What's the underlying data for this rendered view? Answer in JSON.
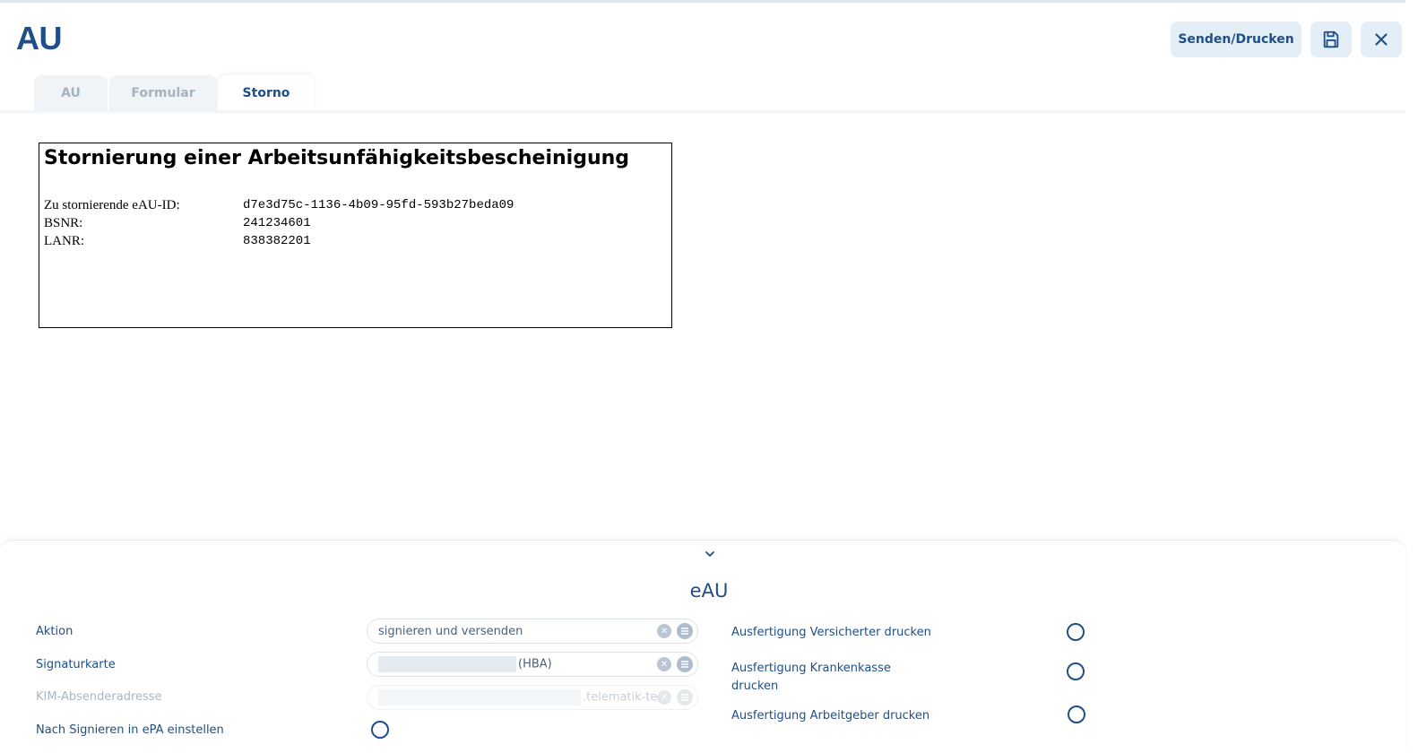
{
  "header": {
    "title": "AU",
    "send_print_label": "Senden/Drucken",
    "icons": {
      "save": "save-icon",
      "close": "close-icon"
    }
  },
  "tabs": [
    {
      "label": "AU",
      "active": false
    },
    {
      "label": "Formular",
      "active": false
    },
    {
      "label": "Storno",
      "active": true
    }
  ],
  "document": {
    "title": "Stornierung einer Arbeitsunfähigkeitsbescheinigung",
    "rows": [
      {
        "label": "Zu stornierende eAU-ID:",
        "value": "d7e3d75c-1136-4b09-95fd-593b27beda09"
      },
      {
        "label": "BSNR:",
        "value": "241234601"
      },
      {
        "label": "LANR:",
        "value": "838382201"
      }
    ]
  },
  "panel": {
    "title": "eAU",
    "fields": {
      "aktion": {
        "label": "Aktion",
        "value": "signieren und versenden"
      },
      "signaturkarte": {
        "label": "Signaturkarte",
        "value_suffix": "(HBA)"
      },
      "kim": {
        "label": "KIM-Absenderadresse",
        "value_suffix": ".telematik-test"
      },
      "epa": {
        "label": "Nach Signieren in ePA einstellen"
      }
    },
    "options": {
      "versicherter": "Ausfertigung Versicherter drucken",
      "krankenkasse_line1": "Ausfertigung Krankenkasse",
      "krankenkasse_line2": "drucken",
      "arbeitgeber": "Ausfertigung Arbeitgeber drucken"
    }
  },
  "colors": {
    "primary": "#1f4f86",
    "button_bg": "#e4eef6",
    "tab_inactive": "#a6b2bf"
  }
}
